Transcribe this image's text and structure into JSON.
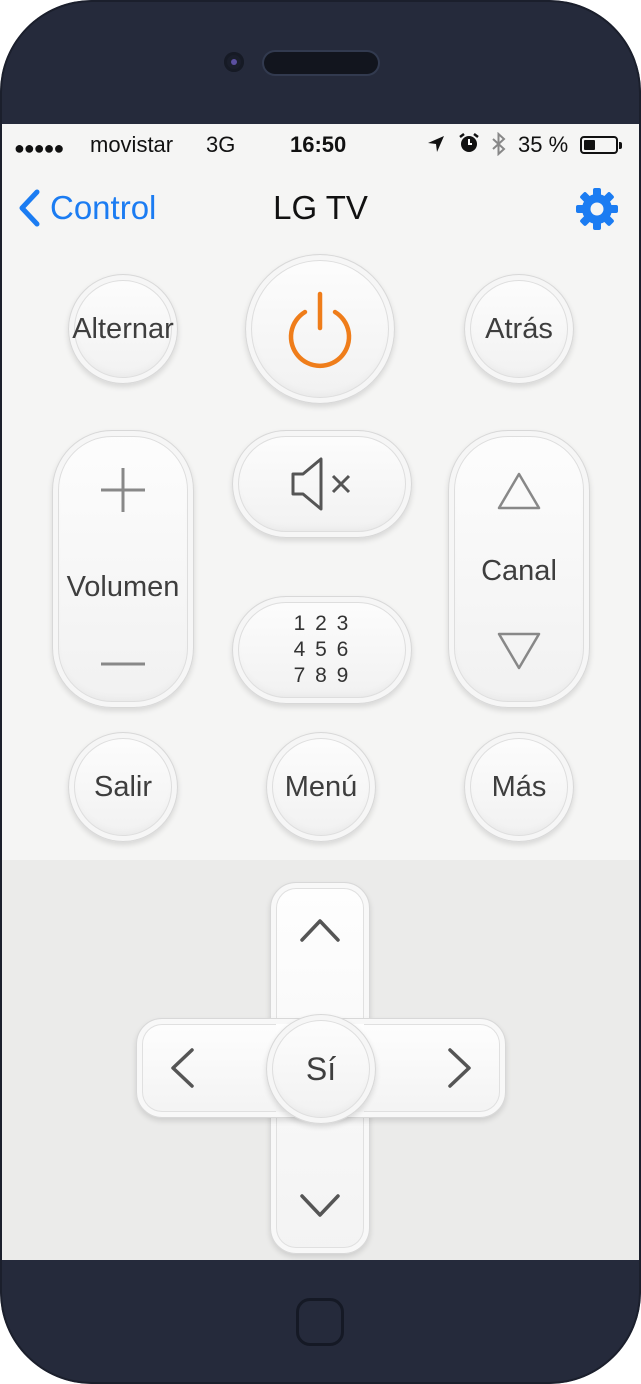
{
  "status_bar": {
    "signal_dots": "●●●●●",
    "carrier": "movistar",
    "network": "3G",
    "time": "16:50",
    "battery_percent_text": "35 %",
    "battery_level": 0.35,
    "icons": [
      "location-icon",
      "alarm-icon",
      "bluetooth-icon",
      "battery-icon"
    ]
  },
  "navbar": {
    "back_label": "Control",
    "title": "LG TV",
    "accent_color": "#1b7cf2"
  },
  "remote": {
    "toggle_label": "Alternar",
    "back_label": "Atrás",
    "volume_label": "Volumen",
    "channel_label": "Canal",
    "keypad_rows": [
      "1 2 3",
      "4 5 6",
      "7 8 9"
    ],
    "exit_label": "Salir",
    "menu_label": "Menú",
    "more_label": "Más",
    "power_color": "#ef7d1a"
  },
  "dpad": {
    "ok_label": "Sí"
  }
}
